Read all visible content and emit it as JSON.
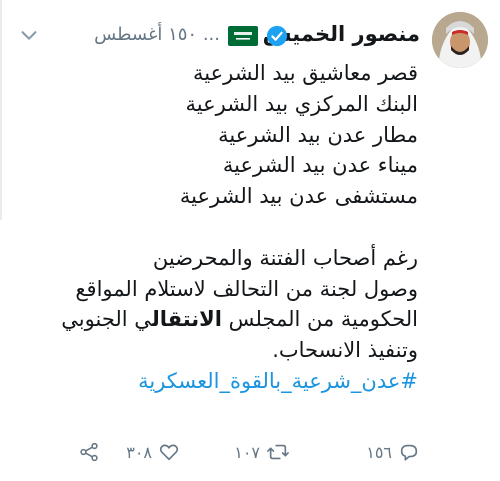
{
  "tweet": {
    "author_name": "منصور الخميس",
    "meta_text": "... ١٥٠ أغسطس",
    "lines": [
      "قصر معاشيق بيد الشرعية",
      "البنك المركزي بيد الشرعية",
      "مطار عدن بيد الشرعية",
      "ميناء عدن بيد الشرعية",
      "مستشفى عدن بيد الشرعية"
    ],
    "para_line1": "رغم أصحاب الفتنة والمحرضين",
    "para_line2": "وصول لجنة من التحالف لاستلام المواقع",
    "para_line3_pre": "الحكومية من المجلس ",
    "para_line3_bold": "الانتقال",
    "para_line3_post": "ي الجنوبي",
    "para_line4": "وتنفيذ الانسحاب.",
    "hashtag": "#عدن_شرعية_بالقوة_العسكرية"
  },
  "actions": {
    "reply_count": "١٥٦",
    "retweet_count": "١٠٧",
    "like_count": "٣٠٨"
  },
  "colors": {
    "link": "#1b95e0",
    "verified": "#1da1f2",
    "muted": "#657786",
    "flag_green": "#006c35"
  },
  "icons": [
    "verified-badge-icon",
    "saudi-flag-icon",
    "chevron-down-icon",
    "reply-icon",
    "retweet-icon",
    "like-icon",
    "share-icon"
  ]
}
